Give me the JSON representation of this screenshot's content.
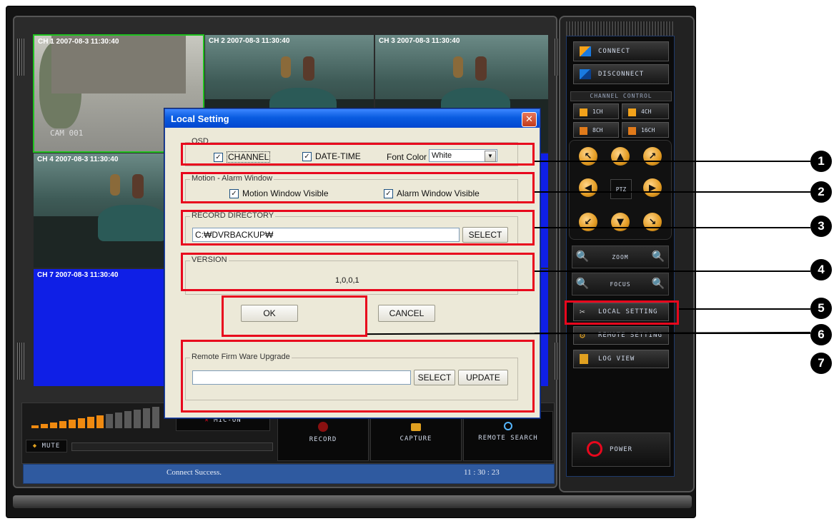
{
  "channels": [
    {
      "label": "CH 1 2007-08-3 11:30:40",
      "cam": "CAM 001"
    },
    {
      "label": "CH 2 2007-08-3 11:30:40"
    },
    {
      "label": "CH 3 2007-08-3 11:30:40"
    },
    {
      "label": "CH 4 2007-08-3 11:30:40"
    },
    {
      "label": "CH 7 2007-08-3 11:30:40"
    }
  ],
  "right_panel": {
    "connect": "CONNECT",
    "disconnect": "DISCONNECT",
    "channel_control": "CHANNEL CONTROL",
    "ch1": "1CH",
    "ch4": "4CH",
    "ch8": "8CH",
    "ch16": "16CH",
    "ptz": "PTZ",
    "zoom": "ZOOM",
    "focus": "FOCUS",
    "local_setting": "LOCAL SETTING",
    "remote_setting": "REMOTE SETTING",
    "log_view": "LOG VIEW",
    "power": "POWER"
  },
  "bottom": {
    "mic": "MIC-ON",
    "mute": "MUTE",
    "record": "RECORD",
    "capture": "CAPTURE",
    "remote_search": "REMOTE SEARCH",
    "status": "Connect Success.",
    "time": "11 : 30 : 23",
    "volume_level": 0.55
  },
  "dialog": {
    "title": "Local Setting",
    "osd": {
      "legend": "OSD",
      "channel": "CHANNEL",
      "datetime": "DATE-TIME",
      "font_color_label": "Font Color",
      "font_color_value": "White"
    },
    "motion": {
      "legend": "Motion - Alarm Window",
      "motion_visible": "Motion Window Visible",
      "alarm_visible": "Alarm Window Visible"
    },
    "record_dir": {
      "legend": "RECORD DIRECTORY",
      "path": "C:₩DVRBACKUP₩",
      "select": "SELECT"
    },
    "version": {
      "legend": "VERSION",
      "value": "1,0,0,1"
    },
    "ok": "OK",
    "cancel": "CANCEL",
    "firmware": {
      "legend": "Remote Firm Ware Upgrade",
      "path": "",
      "select": "SELECT",
      "update": "UPDATE"
    }
  },
  "callouts": [
    "1",
    "2",
    "3",
    "4",
    "5",
    "6",
    "7"
  ],
  "colors": {
    "annotation": "#e8071d",
    "status_bar": "#2f5aa0",
    "ptz_button": "#e29a20"
  }
}
